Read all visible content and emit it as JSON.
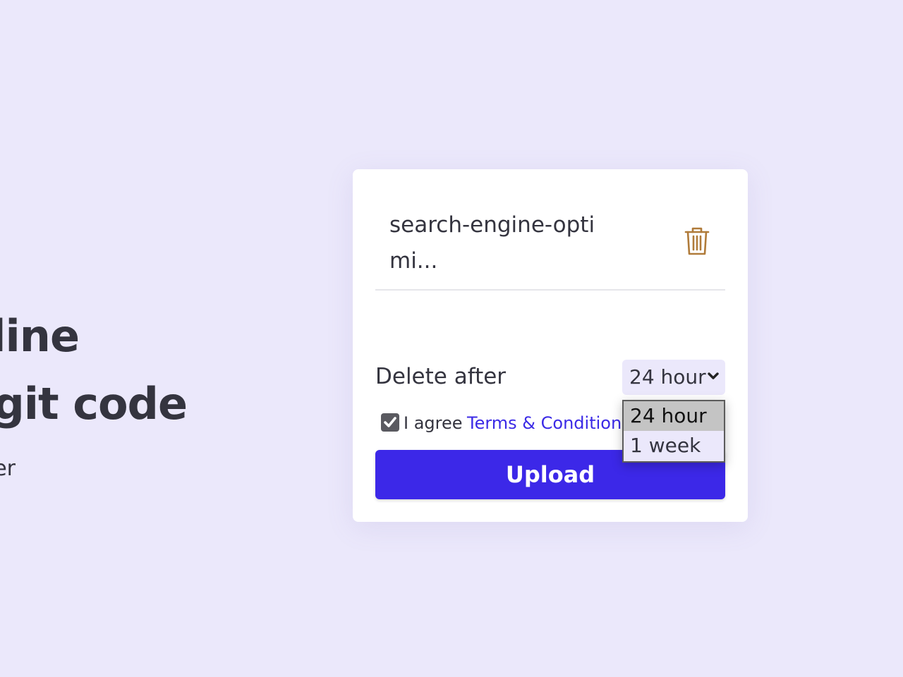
{
  "hero": {
    "line1": "line",
    "line2": "git code",
    "subtitle": "er"
  },
  "file": {
    "name": "search-engine-optimi...",
    "delete_icon": "trash-icon"
  },
  "expiry": {
    "label": "Delete after",
    "selected": "24 hour",
    "options": [
      "24 hour",
      "1 week"
    ]
  },
  "agreement": {
    "checked": true,
    "text": "I agree",
    "link_text": "Terms & Conditions"
  },
  "upload": {
    "label": "Upload"
  },
  "colors": {
    "background": "#ebe8fb",
    "accent": "#3c28e8",
    "link": "#3b2ae6",
    "trash_icon": "#b07b3a",
    "text": "#34343f"
  }
}
